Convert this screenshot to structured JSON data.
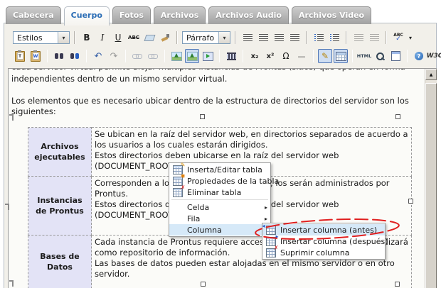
{
  "window": {
    "tabs": [
      {
        "label": "Cabecera",
        "active": false
      },
      {
        "label": "Cuerpo",
        "active": true
      },
      {
        "label": "Fotos",
        "active": false
      },
      {
        "label": "Archivos",
        "active": false
      },
      {
        "label": "Archivos Audio",
        "active": false
      },
      {
        "label": "Archivos Video",
        "active": false
      }
    ]
  },
  "toolbar": {
    "styles_dropdown": "Estilos",
    "format_dropdown": "Párrafo",
    "glyphs": {
      "caret": "▾",
      "bold": "B",
      "italic": "I",
      "underline": "U",
      "strikethrough": "ABC",
      "spell_abc": "ABC",
      "spell_check": "✓",
      "paste_text": "T",
      "paste_word": "W",
      "undo": "↶",
      "redo": "↷",
      "subscript": "x₂",
      "superscript": "x²",
      "omega": "Ω",
      "hrule": "—",
      "pencil": "✎",
      "html": "HTML",
      "w3c": "W3C",
      "help": "?",
      "up_arrow": "▲"
    }
  },
  "editor": {
    "clipped_line": "cada servidor virtual permite alojar múltiples instancias de Prontus (sitios) que operan en forma",
    "line1": "independientes dentro de un mismo servidor virtual.",
    "line2": "Los elementos que es necesario ubicar dentro de la estructura de directorios del servidor son los siguientes:",
    "table": {
      "rows": [
        {
          "header": "Archivos\nejecutables",
          "body": "Se ubican en la raíz del servidor web, en directorios separados de acuerdo a\nlos usuarios a los cuales estarán dirigidos.\nEstos directorios deben ubicarse en la raíz del servidor web\n(DOCUMENT_ROOT)."
        },
        {
          "header": "Instancias\nde Prontus",
          "body": "Corresponden a los directorios de los sitios, los serán administrados por\nProntus.\nEstos directorios deben ubicarse en la raíz del servidor web\n(DOCUMENT_ROOT)."
        },
        {
          "header": "Bases de\nDatos",
          "body": "Cada instancia de Prontus requiere acceso a una base de datos que utilizará\ncomo repositorio de información.\nLas bases de datos pueden estar alojadas en el mismo servidor o en otro\nservidor."
        }
      ]
    }
  },
  "context_menu": {
    "items": [
      {
        "label": "Inserta/Editar tabla"
      },
      {
        "label": "Propiedades de la tabla"
      },
      {
        "label": "Eliminar tabla"
      },
      {
        "label": "Celda"
      },
      {
        "label": "Fila"
      },
      {
        "label": "Columna"
      }
    ],
    "submenu_arrow": "▸",
    "badges": {
      "edit": "✎",
      "props": "✱",
      "delete": "✗"
    }
  },
  "submenu": {
    "items": [
      {
        "label": "Insertar columna (antes)"
      },
      {
        "label": "Insertar columna (después)"
      },
      {
        "label": "Suprimir columna"
      }
    ],
    "badges": {
      "before": "◂",
      "after": "▸",
      "delete": "✗"
    }
  },
  "colors": {
    "active_tab_text": "#2a6db5",
    "menu_highlight": "#d6e9f8",
    "table_header_bg": "#e3e3f6",
    "annotation_red": "#e02020"
  }
}
